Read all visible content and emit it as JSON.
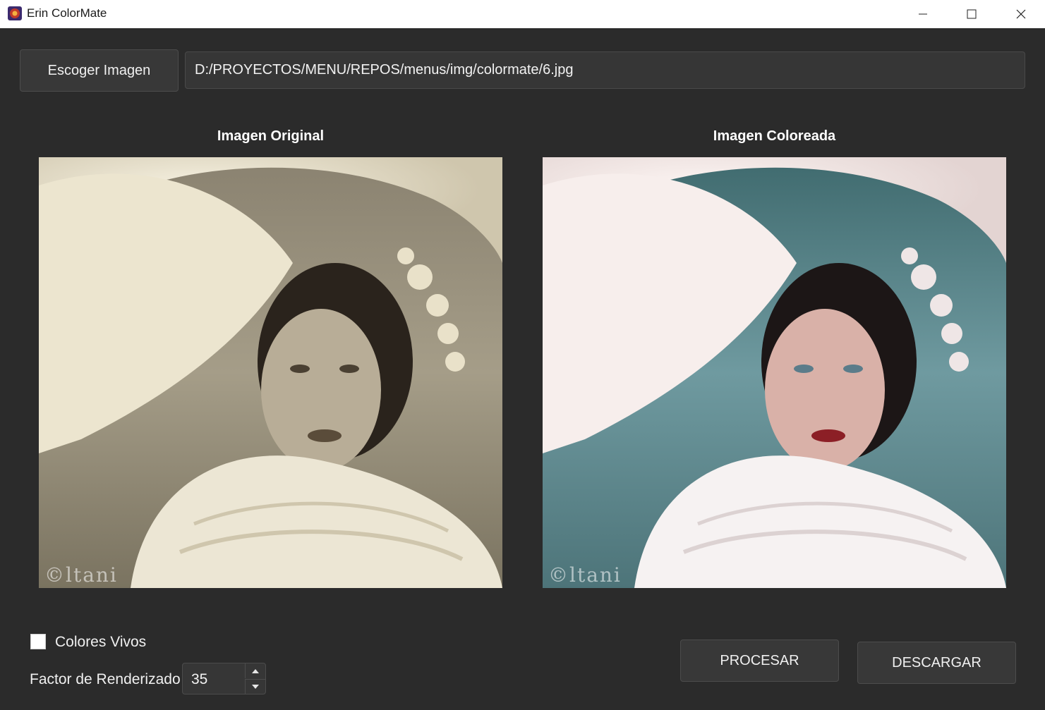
{
  "window": {
    "title": "Erin ColorMate",
    "icon": "colormate-app-icon",
    "controls": [
      "minimize-icon",
      "maximize-icon",
      "close-icon"
    ]
  },
  "toolbar": {
    "choose_label": "Escoger Imagen",
    "file_path": "D:/PROYECTOS/MENU/REPOS/menus/img/colormate/6.jpg"
  },
  "panels": {
    "original_title": "Imagen Original",
    "colored_title": "Imagen Coloreada",
    "watermark": "©ltani"
  },
  "options": {
    "vivid_label": "Colores Vivos",
    "vivid_checked": false,
    "factor_label": "Factor de Renderizado",
    "factor_value": "35"
  },
  "actions": {
    "process_label": "PROCESAR",
    "download_label": "DESCARGAR"
  }
}
